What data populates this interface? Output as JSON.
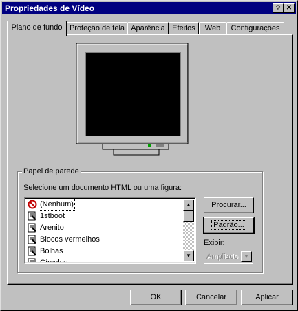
{
  "window": {
    "title": "Propriedades de Vídeo",
    "help_glyph": "?",
    "close_glyph": "✕"
  },
  "tabs": [
    {
      "label": "Plano de fundo",
      "active": true
    },
    {
      "label": "Proteção de tela"
    },
    {
      "label": "Aparência"
    },
    {
      "label": "Efeitos"
    },
    {
      "label": "Web"
    },
    {
      "label": "Configurações"
    }
  ],
  "wallpaper": {
    "group_label": "Papel de parede",
    "list_label": "Selecione um documento HTML ou uma figura:",
    "items": [
      {
        "label": "(Nenhum)",
        "icon": "no-symbol-icon",
        "selected": true
      },
      {
        "label": "1stboot",
        "icon": "wallpaper-file-icon"
      },
      {
        "label": "Arenito",
        "icon": "wallpaper-file-icon"
      },
      {
        "label": "Blocos vermelhos",
        "icon": "wallpaper-file-icon"
      },
      {
        "label": "Bolhas",
        "icon": "wallpaper-file-icon"
      },
      {
        "label": "Círculos",
        "icon": "wallpaper-file-icon"
      }
    ],
    "browse_label": "Procurar...",
    "pattern_label": "Padrão...",
    "display_label": "Exibir:",
    "display_value": "Ampliado"
  },
  "footer": {
    "ok_label": "OK",
    "cancel_label": "Cancelar",
    "apply_label": "Aplicar"
  },
  "colors": {
    "titlebar": "#000080",
    "face": "#c0c0c0",
    "monitor_screen": "#000000",
    "power_led": "#00a000"
  }
}
